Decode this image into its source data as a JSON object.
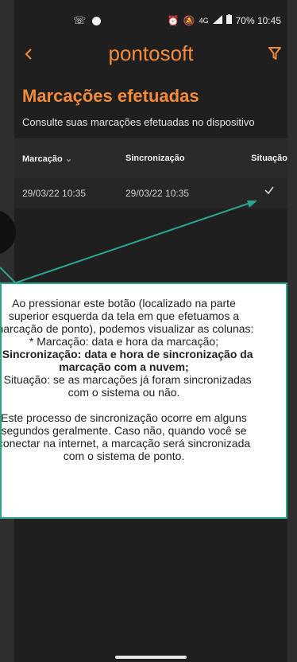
{
  "status_bar": {
    "left_icons": [
      "wifi-calling-icon",
      "dot-icon"
    ],
    "right_text": "70% 10:45",
    "network": "4G",
    "icons": [
      "alarm-icon",
      "mute-icon",
      "volte-icon",
      "signal-icon",
      "battery-icon"
    ]
  },
  "app": {
    "logo": "pontosoft",
    "back_icon": "chevron-left-icon",
    "filter_icon": "filter-icon",
    "accent": "#f28a3a"
  },
  "page": {
    "title": "Marcações efetuadas",
    "subtitle": "Consulte suas marcações efetuadas no dispositivo"
  },
  "table": {
    "headers": [
      "Marcação",
      "Sincronização",
      "Situação"
    ],
    "rows": [
      {
        "marcacao": "29/03/22 10:35",
        "sincronizacao": "29/03/22 10:35",
        "situacao": "check"
      }
    ]
  },
  "callout": {
    "lines": [
      "Ao pressionar este botão (localizado na parte",
      "superior esquerda da tela em que efetuamos a",
      "marcação de ponto), podemos visualizar as colunas:",
      "* Marcação: data e hora da marcação;",
      "* Sincronização: data e hora de sincronização da",
      "marcação com a nuvem;",
      "* Situação: se as marcações já foram sincronizadas",
      "com o sistema ou não.",
      "",
      "Este processo de sincronização ocorre em alguns",
      "segundos geralmente. Caso não, quando você se",
      "conectar na internet, a marcação será sincronizada",
      "com o sistema de ponto."
    ],
    "border_color": "#2ba58f"
  }
}
